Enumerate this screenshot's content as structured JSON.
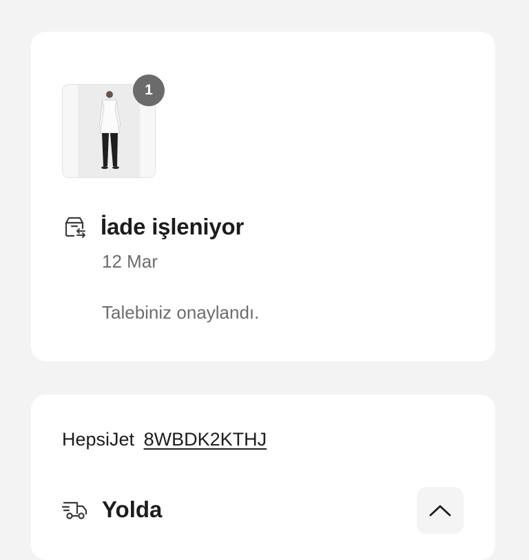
{
  "product": {
    "quantity_badge": "1"
  },
  "return_status": {
    "icon": "box-return-icon",
    "title": "İade işleniyor",
    "date": "12 Mar",
    "note": "Talebiniz onaylandı."
  },
  "shipment": {
    "carrier": "HepsiJet",
    "tracking_code": "8WBDK2KTHJ",
    "icon": "truck-icon",
    "status": "Yolda",
    "toggle_icon": "chevron-up-icon"
  },
  "colors": {
    "background": "#f3f3f3",
    "card": "#ffffff",
    "badge": "#6b6b6b",
    "muted_text": "#6c6c6c"
  }
}
